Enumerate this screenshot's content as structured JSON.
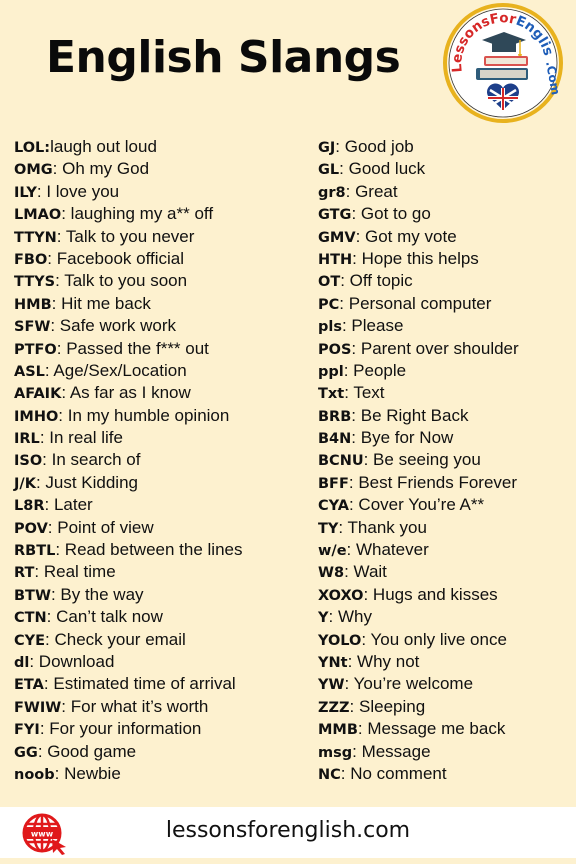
{
  "title": "English Slangs",
  "logo": {
    "brand_text_lessons": "Lessons",
    "brand_text_for": "For",
    "brand_text_english": "English",
    "brand_text_com": ".Com",
    "colors": {
      "ring": "#e8b21e",
      "lessons": "#d62828",
      "english": "#1e5db8",
      "book_red": "#d9534f",
      "book_blue": "#2e5c7a",
      "cap": "#2f4858"
    }
  },
  "left_column": [
    {
      "abbr": "LOL:",
      "meaning": "laugh out loud"
    },
    {
      "abbr": "OMG",
      "meaning": ": Oh my God"
    },
    {
      "abbr": "ILY",
      "meaning": ": I love you"
    },
    {
      "abbr": "LMAO",
      "meaning": ": laughing my a** off"
    },
    {
      "abbr": "TTYN",
      "meaning": ": Talk to you never"
    },
    {
      "abbr": "FBO",
      "meaning": ": Facebook official"
    },
    {
      "abbr": "TTYS",
      "meaning": ": Talk to you soon"
    },
    {
      "abbr": "HMB",
      "meaning": ": Hit me back"
    },
    {
      "abbr": "SFW",
      "meaning": ": Safe work work"
    },
    {
      "abbr": "PTFO",
      "meaning": ": Passed the f*** out"
    },
    {
      "abbr": "ASL",
      "meaning": ": Age/Sex/Location"
    },
    {
      "abbr": "AFAIK",
      "meaning": ": As far as I know"
    },
    {
      "abbr": "IMHO",
      "meaning": ": In my humble opinion"
    },
    {
      "abbr": "IRL",
      "meaning": ": In real life"
    },
    {
      "abbr": "ISO",
      "meaning": ": In search of"
    },
    {
      "abbr": "J/K",
      "meaning": ": Just Kidding"
    },
    {
      "abbr": "L8R",
      "meaning": ": Later"
    },
    {
      "abbr": "POV",
      "meaning": ": Point of view"
    },
    {
      "abbr": "RBTL",
      "meaning": ": Read between the lines"
    },
    {
      "abbr": "RT",
      "meaning": ": Real time"
    },
    {
      "abbr": "BTW",
      "meaning": ": By the way"
    },
    {
      "abbr": "CTN",
      "meaning": ": Can’t talk now"
    },
    {
      "abbr": "CYE",
      "meaning": ": Check your email"
    },
    {
      "abbr": "dl",
      "meaning": ": Download"
    },
    {
      "abbr": "ETA",
      "meaning": ": Estimated time of arrival"
    },
    {
      "abbr": "FWIW",
      "meaning": ": For what it’s worth"
    },
    {
      "abbr": "FYI",
      "meaning": ": For your information"
    },
    {
      "abbr": "GG",
      "meaning": ": Good game"
    },
    {
      "abbr": "noob",
      "meaning": ": Newbie"
    }
  ],
  "right_column": [
    {
      "abbr": "GJ",
      "meaning": ": Good job"
    },
    {
      "abbr": "GL",
      "meaning": ": Good luck"
    },
    {
      "abbr": "gr8",
      "meaning": ": Great"
    },
    {
      "abbr": "GTG",
      "meaning": ": Got to go"
    },
    {
      "abbr": "GMV",
      "meaning": ": Got my vote"
    },
    {
      "abbr": "HTH",
      "meaning": ": Hope this helps"
    },
    {
      "abbr": "OT",
      "meaning": ": Off topic"
    },
    {
      "abbr": "PC",
      "meaning": ": Personal computer"
    },
    {
      "abbr": "pls",
      "meaning": ": Please"
    },
    {
      "abbr": "POS",
      "meaning": ": Parent over shoulder"
    },
    {
      "abbr": "ppl",
      "meaning": ": People"
    },
    {
      "abbr": "Txt",
      "meaning": ": Text"
    },
    {
      "abbr": "BRB",
      "meaning": ": Be Right Back"
    },
    {
      "abbr": "B4N",
      "meaning": ": Bye for Now"
    },
    {
      "abbr": "BCNU",
      "meaning": ": Be seeing you"
    },
    {
      "abbr": "BFF",
      "meaning": ": Best Friends Forever"
    },
    {
      "abbr": "CYA",
      "meaning": ": Cover You’re A**"
    },
    {
      "abbr": "TY",
      "meaning": ": Thank you"
    },
    {
      "abbr": "w/e",
      "meaning": ": Whatever"
    },
    {
      "abbr": "W8",
      "meaning": ": Wait"
    },
    {
      "abbr": "XOXO",
      "meaning": ": Hugs and kisses"
    },
    {
      "abbr": "Y",
      "meaning": ": Why"
    },
    {
      "abbr": "YOLO",
      "meaning": ": You only live once"
    },
    {
      "abbr": "YNt",
      "meaning": ": Why not"
    },
    {
      "abbr": "YW",
      "meaning": ": You’re welcome"
    },
    {
      "abbr": "ZZZ",
      "meaning": ": Sleeping"
    },
    {
      "abbr": "MMB",
      "meaning": ": Message me back"
    },
    {
      "abbr": "msg",
      "meaning": ": Message"
    },
    {
      "abbr": "NC",
      "meaning": ": No comment"
    }
  ],
  "footer": {
    "icon": "globe-www-cursor-icon",
    "icon_label": "www",
    "url": "lessonsforenglish.com",
    "icon_color": "#e0191b"
  },
  "colors": {
    "background": "#fdf1cf",
    "footer_background": "#ffffff",
    "text": "#111111"
  }
}
